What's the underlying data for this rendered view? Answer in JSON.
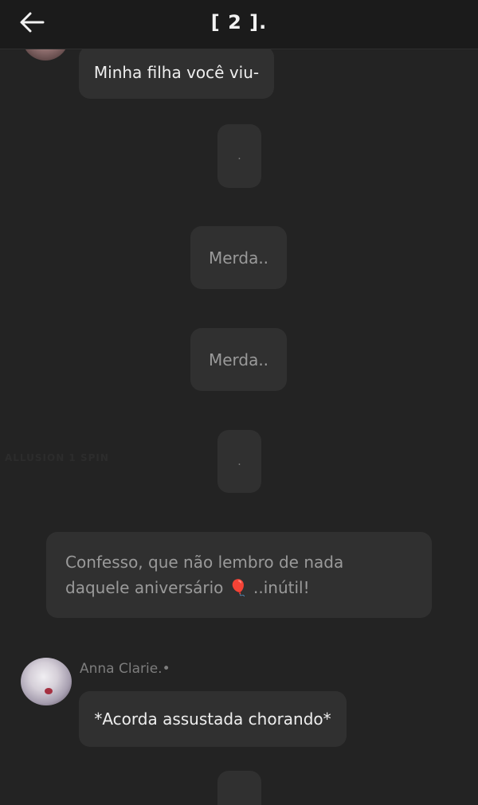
{
  "header": {
    "title": "[ 2 ].",
    "back_icon": "arrow-left-icon"
  },
  "messages": [
    {
      "text": "Minha filha você viu-"
    },
    {
      "text": "."
    },
    {
      "text": "Merda.."
    },
    {
      "text": "Merda.."
    },
    {
      "text": "."
    },
    {
      "text": "Confesso, que não lembro de nada daquele aniversário 🎈 ..inútil!"
    },
    {
      "sender": "Anna Clarie.•",
      "text": "*Acorda assustada chorando*"
    }
  ],
  "faint_label": "ALLUSION 1 SPIN",
  "colors": {
    "background": "#232323",
    "header": "#1b1b1b",
    "bubble": "#303030",
    "text_bright": "#eeeeee",
    "text_dim": "#9a9a9a"
  }
}
